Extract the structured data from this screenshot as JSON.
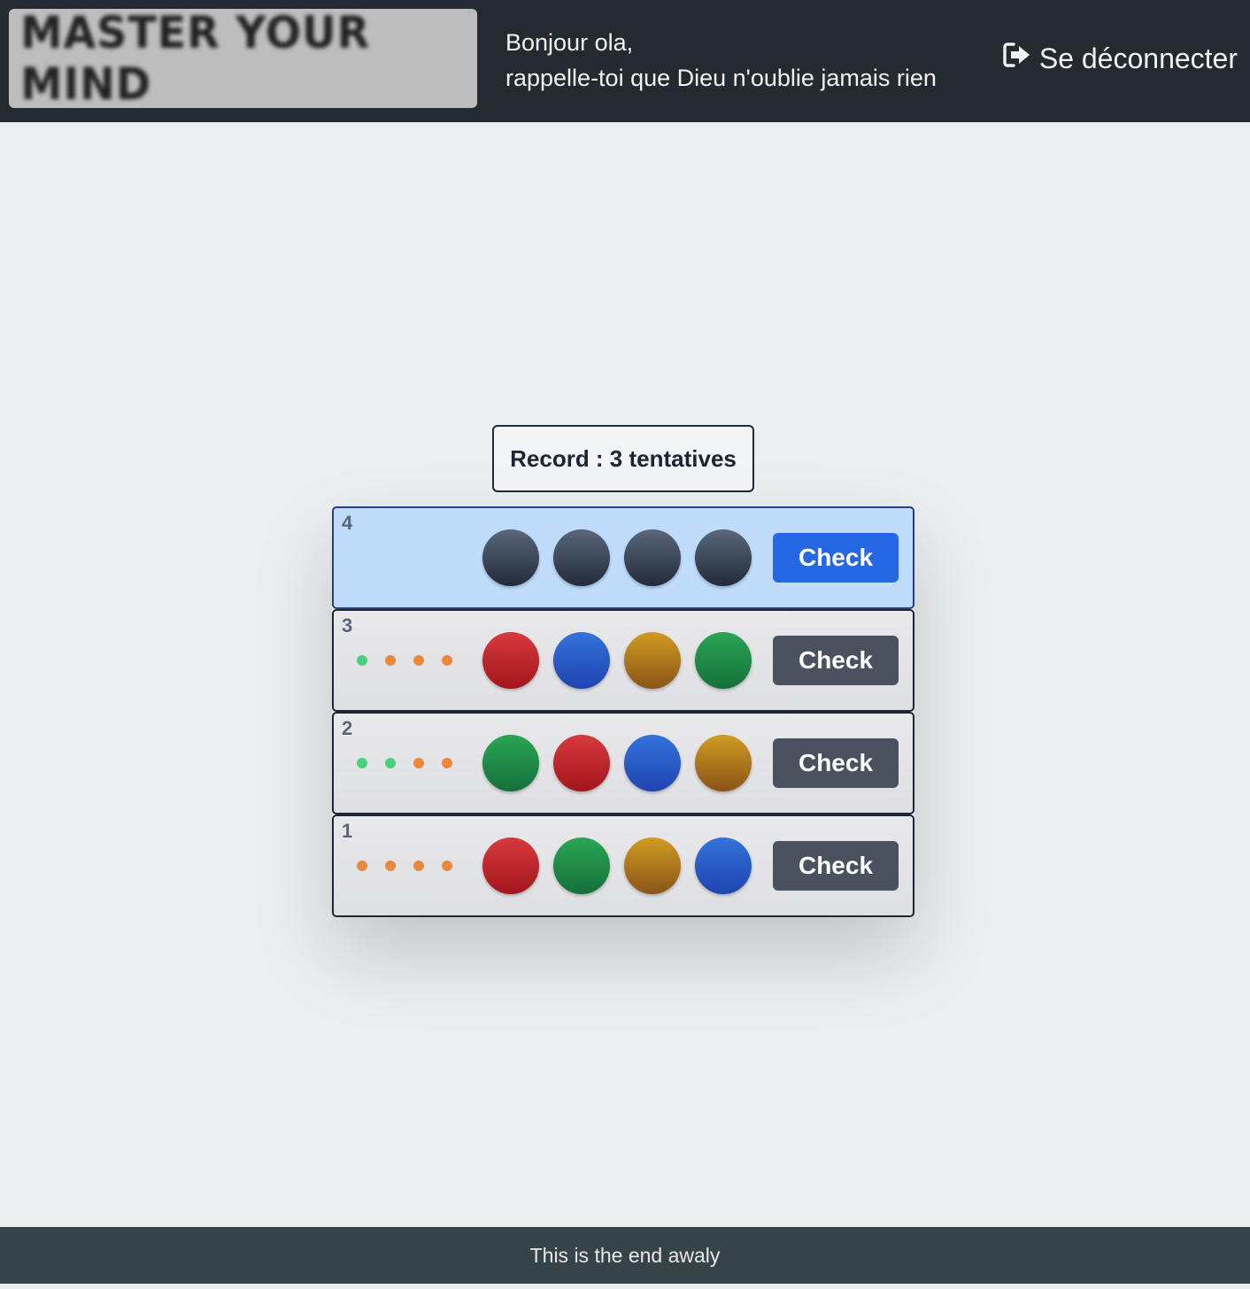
{
  "header": {
    "logo_text": "MASTER YOUR MIND",
    "greeting_line1": "Bonjour ola,",
    "greeting_line2": "rappelle-toi que Dieu n'oublie jamais rien",
    "logout_label": "Se déconnecter",
    "logout_icon": "sign-out-icon"
  },
  "record": {
    "label": "Record : 3 tentatives"
  },
  "board": {
    "check_label": "Check",
    "rows": [
      {
        "number": "4",
        "active": true,
        "pegs": [
          "grey",
          "grey",
          "grey",
          "grey"
        ],
        "hints": []
      },
      {
        "number": "3",
        "active": false,
        "pegs": [
          "red",
          "blue",
          "gold",
          "green"
        ],
        "hints": [
          "green",
          "orange",
          "orange",
          "orange"
        ]
      },
      {
        "number": "2",
        "active": false,
        "pegs": [
          "green",
          "red",
          "blue",
          "gold"
        ],
        "hints": [
          "green",
          "green",
          "orange",
          "orange"
        ]
      },
      {
        "number": "1",
        "active": false,
        "pegs": [
          "red",
          "green",
          "gold",
          "blue"
        ],
        "hints": [
          "orange",
          "orange",
          "orange",
          "orange"
        ]
      }
    ]
  },
  "footer": {
    "text": "This is the end awaly"
  },
  "colors": {
    "header_bg": "#232a30",
    "page_bg": "#eceff0",
    "active_row_bg": "#bfdcfb",
    "primary_button": "#2667e3",
    "secondary_button": "#4a5260",
    "hint_green": "#4cd07d",
    "hint_orange": "#e98a3c",
    "footer_bg": "#364349"
  }
}
